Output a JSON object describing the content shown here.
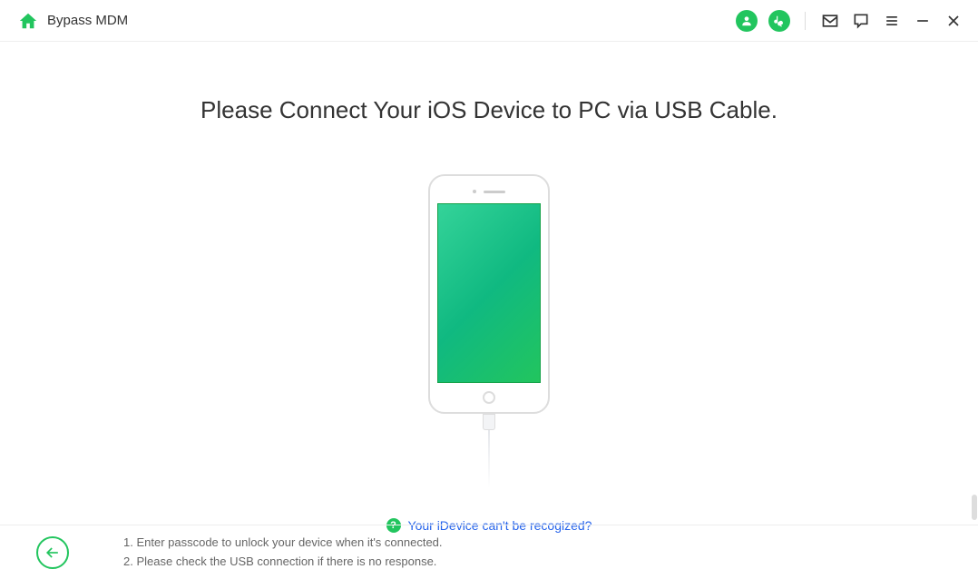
{
  "header": {
    "title": "Bypass MDM"
  },
  "main": {
    "heading": "Please Connect Your iOS Device to PC via USB Cable.",
    "help_text": "Your iDevice can't be recogized?"
  },
  "footer": {
    "instruction1": "1. Enter passcode to unlock your device when it's connected.",
    "instruction2": "2. Please check the USB connection if there is no response."
  }
}
